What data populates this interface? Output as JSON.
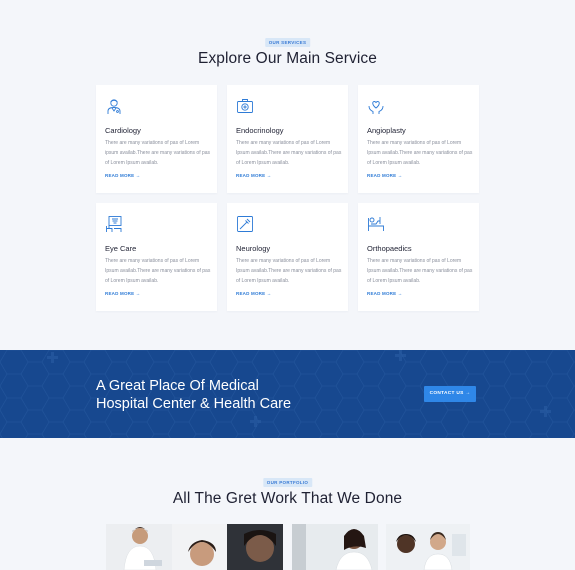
{
  "services_section": {
    "badge": "OUR SERVICES",
    "title": "Explore Our Main Service",
    "cards": [
      {
        "title": "Cardiology",
        "icon": "doctor-icon",
        "desc": "There are many variations of pas of Lorem ipsum availab.There are many variations of pas of Lorem Ipsum availab.",
        "link": "READ MORE"
      },
      {
        "title": "Endocrinology",
        "icon": "medical-kit-icon",
        "desc": "There are many variations of pas of Lorem Ipsum availab.There are many variations of pas of Lorem Ipsum availab.",
        "link": "READ MORE"
      },
      {
        "title": "Angioplasty",
        "icon": "hand-heart-icon",
        "desc": "There are many variations of pas of Lorem Ipsum availab.There are many variations of pas of Lorem Ipsum availab.",
        "link": "READ MORE"
      },
      {
        "title": "Eye Care",
        "icon": "eye-chart-icon",
        "desc": "There are many variations of pas of Lorem Ipsum availab.There are many variations of pas of Lorem Ipsum availab.",
        "link": "READ MORE"
      },
      {
        "title": "Neurology",
        "icon": "syringe-icon",
        "desc": "There are many variations of pas of Lorem Ipsum availab.There are many variations of pas of Lorem Ipsum availab.",
        "link": "READ MORE"
      },
      {
        "title": "Orthopaedics",
        "icon": "hospital-bed-icon",
        "desc": "There are many variations of pas of Lorem Ipsum availab.There are many variations of pas of Lorem Ipsum availab.",
        "link": "READ MORE"
      }
    ]
  },
  "cta_banner": {
    "line1": "A Great Place Of Medical",
    "line2": "Hospital Center & Health Care",
    "button": "CONTACT US"
  },
  "portfolio_section": {
    "badge": "OUR PORTFOLIO",
    "title": "All The Gret Work That We Done"
  },
  "colors": {
    "page_bg": "#f4f6fa",
    "accent": "#2e7bd6",
    "banner_bg": "#17488f",
    "button_bg": "#2f87e8",
    "heading": "#1f2133"
  }
}
